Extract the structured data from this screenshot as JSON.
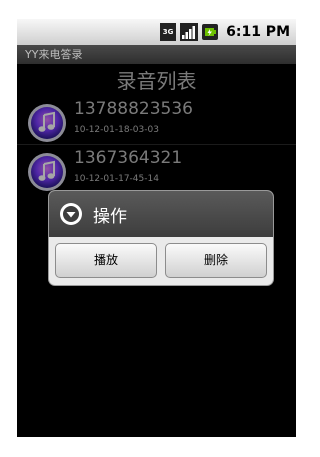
{
  "status_bar": {
    "network": "3G",
    "time": "6:11 PM",
    "icons": [
      "3g-icon",
      "signal-icon",
      "battery-icon"
    ]
  },
  "app": {
    "title": "YY来电答录"
  },
  "list": {
    "heading": "录音列表",
    "items": [
      {
        "number": "13788823536",
        "timestamp": "10-12-01-18-03-03"
      },
      {
        "number": "1367364321",
        "timestamp": "10-12-01-17-45-14"
      }
    ]
  },
  "dialog": {
    "title": "操作",
    "buttons": {
      "play": "播放",
      "delete": "删除"
    }
  },
  "colors": {
    "background": "#000000",
    "text_gray": "#bcbcbc",
    "dialog_header": "#4a4a4a",
    "dialog_body": "#eaeaea"
  }
}
